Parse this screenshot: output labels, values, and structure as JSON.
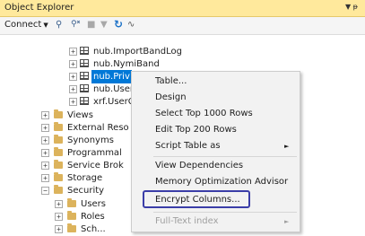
{
  "panel": {
    "title": "Object Explorer",
    "pin_glyph": "▼ ᵽ"
  },
  "toolbar": {
    "connect_label": "Connect",
    "connect_caret": "▼",
    "icons": [
      "connect-object-explorer-icon",
      "disconnect-icon",
      "stop-icon",
      "filter-icon",
      "refresh-icon",
      "activity-monitor-icon"
    ]
  },
  "tree": {
    "tables": [
      {
        "label": "nub.ImportBandLog"
      },
      {
        "label": "nub.NymiBand"
      },
      {
        "label": "nub.Priv",
        "selected": true
      },
      {
        "label": "nub.User"
      },
      {
        "label": "xrf.UserC"
      }
    ],
    "folders": [
      {
        "label": "Views"
      },
      {
        "label": "External Reso"
      },
      {
        "label": "Synonyms"
      },
      {
        "label": "Programmal"
      },
      {
        "label": "Service Brok"
      },
      {
        "label": "Storage"
      },
      {
        "label": "Security",
        "expanded": true
      }
    ],
    "security_children": [
      {
        "label": "Users"
      },
      {
        "label": "Roles"
      },
      {
        "label": "Sch..."
      }
    ]
  },
  "context_menu": {
    "items": [
      {
        "label": "Table..."
      },
      {
        "label": "Design"
      },
      {
        "label": "Select Top 1000 Rows"
      },
      {
        "label": "Edit Top 200 Rows"
      },
      {
        "label": "Script Table as",
        "submenu": true
      },
      {
        "label": "View Dependencies"
      },
      {
        "label": "Memory Optimization Advisor"
      },
      {
        "label": "Encrypt Columns...",
        "highlighted": true
      },
      {
        "label": "Full-Text index",
        "submenu": true,
        "disabled": true
      }
    ],
    "submenu_arrow": "►"
  },
  "colors": {
    "title_bar": "#ffe99c",
    "selection": "#0078d7",
    "highlight_border": "#3b3ea8",
    "folder": "#dcb35c"
  }
}
